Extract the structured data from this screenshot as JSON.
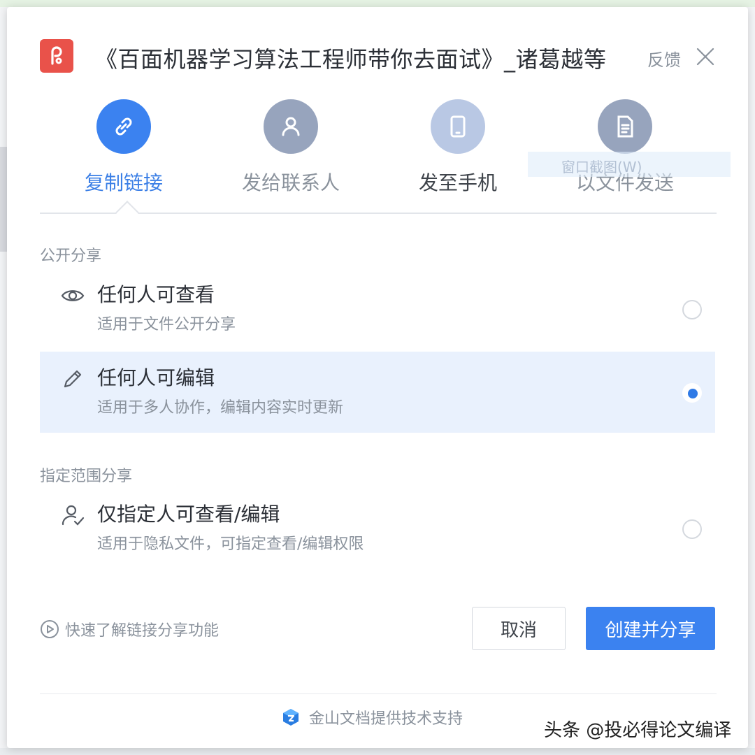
{
  "dialog": {
    "title": "《百面机器学习算法工程师带你去面试》_诸葛越等",
    "feedback_label": "反馈"
  },
  "tabs": [
    {
      "label": "复制链接",
      "icon": "link-icon",
      "active": true
    },
    {
      "label": "发给联系人",
      "icon": "person-icon",
      "active": false
    },
    {
      "label": "发至手机",
      "icon": "phone-icon",
      "active": false
    },
    {
      "label": "以文件发送",
      "icon": "file-icon",
      "active": false
    }
  ],
  "ghost_tooltip": "窗口截图(W)",
  "public_share": {
    "section_label": "公开分享",
    "options": [
      {
        "title": "任何人可查看",
        "desc": "适用于文件公开分享",
        "icon": "eye-icon",
        "selected": false
      },
      {
        "title": "任何人可编辑",
        "desc": "适用于多人协作，编辑内容实时更新",
        "icon": "pencil-icon",
        "selected": true
      }
    ]
  },
  "restricted_share": {
    "section_label": "指定范围分享",
    "options": [
      {
        "title": "仅指定人可查看/编辑",
        "desc": "适用于隐私文件，可指定查看/编辑权限",
        "icon": "person-check-icon",
        "selected": false
      }
    ]
  },
  "help_link": "快速了解链接分享功能",
  "buttons": {
    "cancel": "取消",
    "create": "创建并分享"
  },
  "footer": "金山文档提供技术支持",
  "watermark": "头条 @投必得论文编译",
  "colors": {
    "accent": "#3b82f0",
    "logo_red": "#e9524a",
    "selected_bg": "#e9f1fd",
    "muted_text": "#8a929c"
  }
}
